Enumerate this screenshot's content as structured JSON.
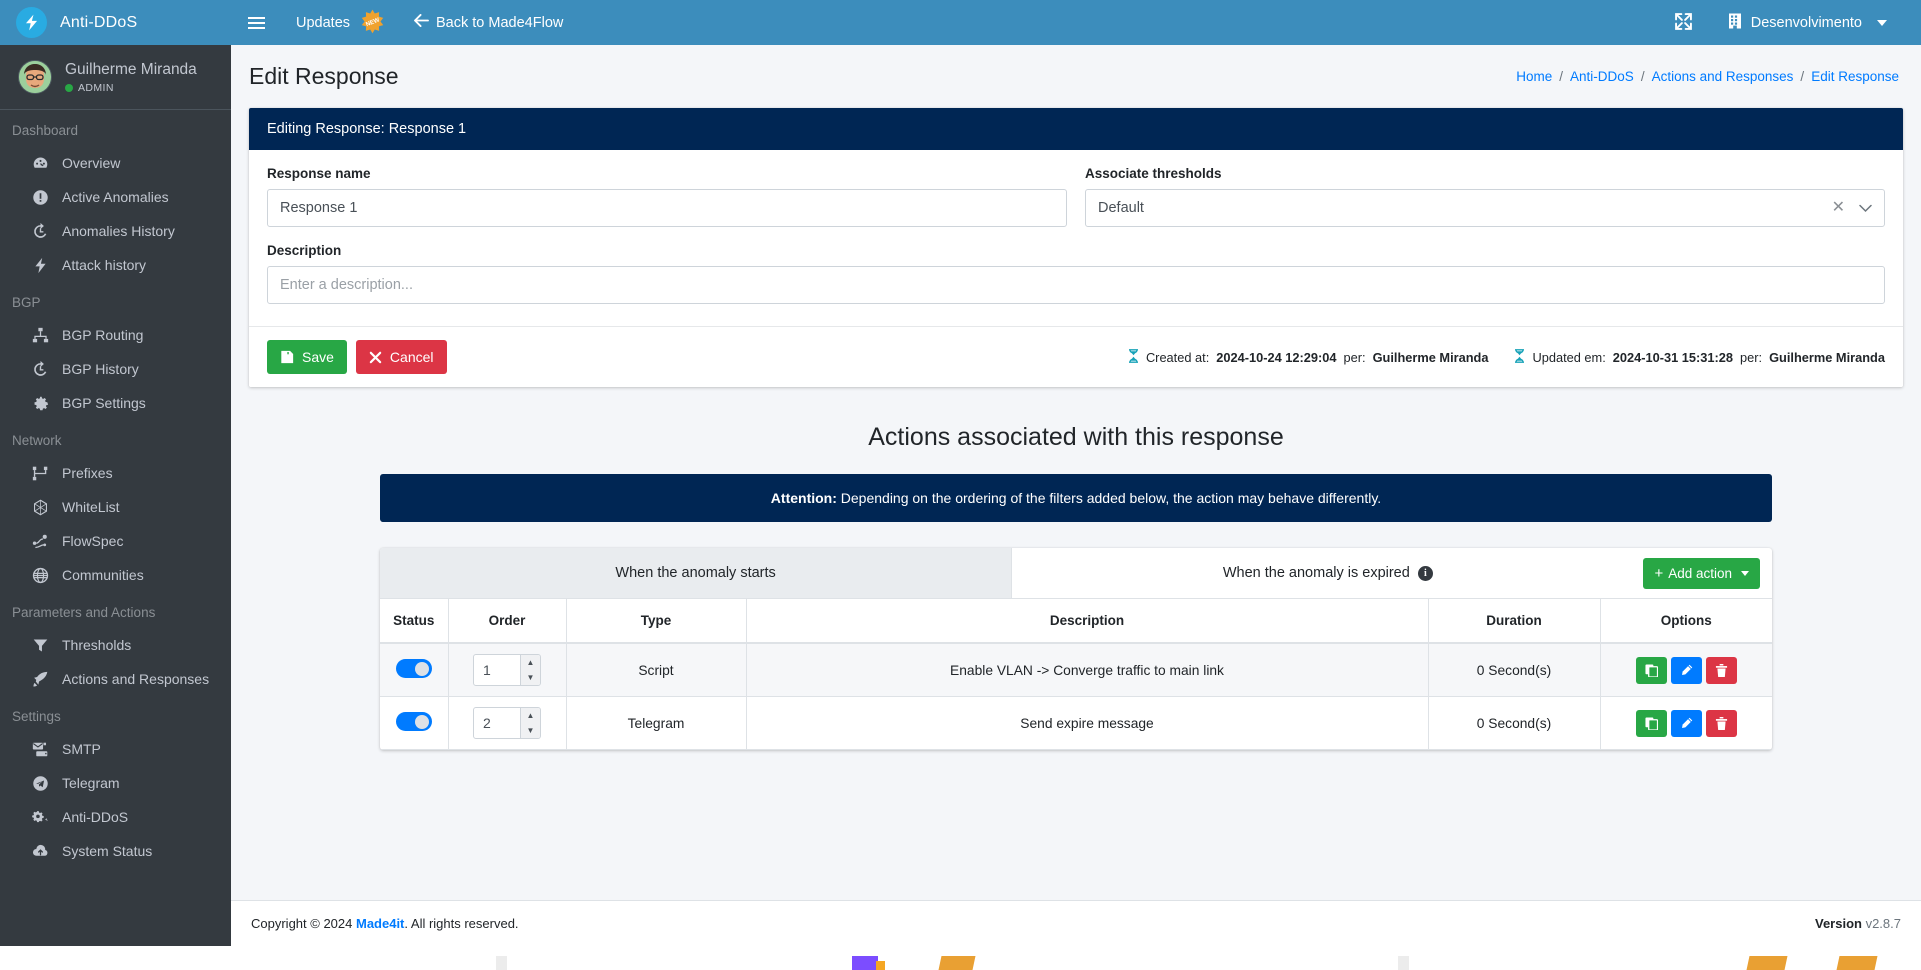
{
  "navbar": {
    "brand": "Anti-DDoS",
    "menu_toggle": "menu-toggle",
    "updates_label": "Updates",
    "new_badge": "NEW",
    "back_label": "Back to Made4Flow",
    "fullscreen_icon": "expand-arrows-icon",
    "org_name": "Desenvolvimento"
  },
  "sidebar": {
    "user": {
      "name": "Guilherme Miranda",
      "role": "ADMIN"
    },
    "sections": [
      {
        "title": "Dashboard",
        "items": [
          {
            "label": "Overview",
            "icon": "gauge-icon"
          },
          {
            "label": "Active Anomalies",
            "icon": "exclamation-circle-icon"
          },
          {
            "label": "Anomalies History",
            "icon": "history-icon"
          },
          {
            "label": "Attack history",
            "icon": "bolt-icon"
          }
        ]
      },
      {
        "title": "BGP",
        "items": [
          {
            "label": "BGP Routing",
            "icon": "sitemap-icon"
          },
          {
            "label": "BGP History",
            "icon": "history-icon"
          },
          {
            "label": "BGP Settings",
            "icon": "gear-icon"
          }
        ]
      },
      {
        "title": "Network",
        "items": [
          {
            "label": "Prefixes",
            "icon": "network-branch-icon"
          },
          {
            "label": "WhiteList",
            "icon": "hexagon-nodes-icon"
          },
          {
            "label": "FlowSpec",
            "icon": "flow-route-icon"
          },
          {
            "label": "Communities",
            "icon": "globe-icon"
          }
        ]
      },
      {
        "title": "Parameters and Actions",
        "items": [
          {
            "label": "Thresholds",
            "icon": "filter-icon"
          },
          {
            "label": "Actions and Responses",
            "icon": "rocket-icon"
          }
        ]
      },
      {
        "title": "Settings",
        "items": [
          {
            "label": "SMTP",
            "icon": "mail-server-icon"
          },
          {
            "label": "Telegram",
            "icon": "telegram-icon"
          },
          {
            "label": "Anti-DDoS",
            "icon": "gears-icon"
          },
          {
            "label": "System Status",
            "icon": "cloud-upload-icon"
          }
        ]
      }
    ]
  },
  "header": {
    "title": "Edit Response",
    "breadcrumb": [
      "Home",
      "Anti-DDoS",
      "Actions and Responses",
      "Edit Response"
    ]
  },
  "edit_card": {
    "title": "Editing Response: Response 1",
    "response_name_label": "Response name",
    "response_name_value": "Response 1",
    "thresholds_label": "Associate thresholds",
    "thresholds_value": "Default",
    "description_label": "Description",
    "description_value": "",
    "description_placeholder": "Enter a description...",
    "save_label": "Save",
    "cancel_label": "Cancel",
    "created_prefix": "Created at:",
    "created_at": "2024-10-24 12:29:04",
    "created_per_label": "per:",
    "created_by": "Guilherme Miranda",
    "updated_prefix": "Updated em:",
    "updated_at": "2024-10-31 15:31:28",
    "updated_per_label": "per:",
    "updated_by": "Guilherme Miranda"
  },
  "actions": {
    "section_title": "Actions associated with this response",
    "alert_bold": "Attention:",
    "alert_text": " Depending on the ordering of the filters added below, the action may behave differently.",
    "tab_start": "When the anomaly starts",
    "tab_expired": "When the anomaly is expired",
    "add_action_label": "Add action",
    "columns": [
      "Status",
      "Order",
      "Type",
      "Description",
      "Duration",
      "Options"
    ],
    "rows": [
      {
        "enabled": true,
        "order": "1",
        "type": "Script",
        "description": "Enable VLAN -> Converge traffic to main link",
        "duration": "0 Second(s)"
      },
      {
        "enabled": true,
        "order": "2",
        "type": "Telegram",
        "description": "Send expire message",
        "duration": "0 Second(s)"
      }
    ],
    "row_buttons": [
      "copy-icon",
      "edit-icon",
      "delete-icon"
    ]
  },
  "footer": {
    "copyright_prefix": "Copyright © 2024 ",
    "brand": "Made4it",
    "copyright_suffix": ". All rights reserved.",
    "version_label": "Version ",
    "version_value": "v2.8.7"
  },
  "colors": {
    "navbar": "#3c8dbc",
    "sidebar": "#343a40",
    "card_dark": "#002654",
    "accent_link": "#007bff",
    "success": "#28a745",
    "danger": "#dc3545",
    "info": "#17a2b8"
  }
}
